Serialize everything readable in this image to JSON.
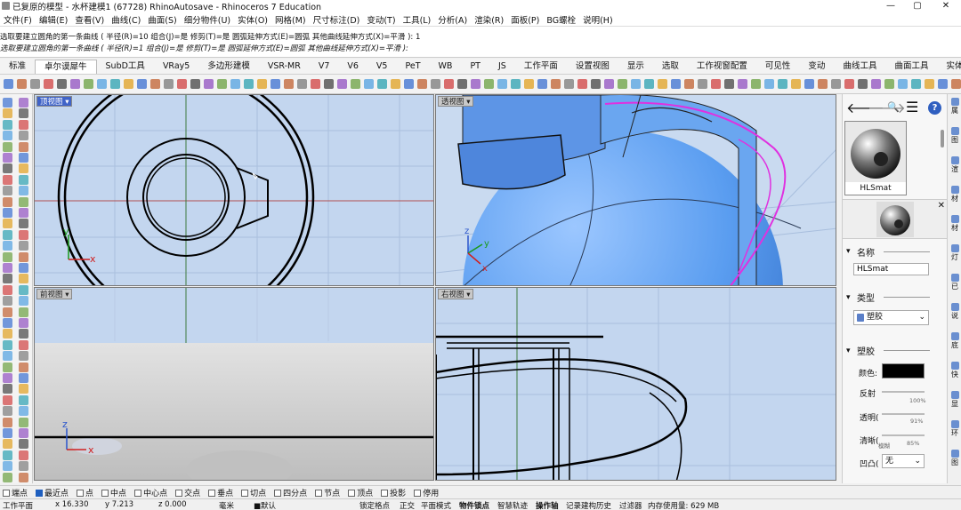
{
  "window": {
    "title": "已复原的模型 - 水杯建模1 (67728) RhinoAutosave - Rhinoceros 7 Education",
    "minimize": "—",
    "maximize": "▢",
    "close": "✕"
  },
  "menu": [
    "文件(F)",
    "编辑(E)",
    "查看(V)",
    "曲线(C)",
    "曲面(S)",
    "细分物件(U)",
    "实体(O)",
    "网格(M)",
    "尺寸标注(D)",
    "变动(T)",
    "工具(L)",
    "分析(A)",
    "渲染(R)",
    "面板(P)",
    "BG螺栓",
    "说明(H)"
  ],
  "command": {
    "line1": "选取要建立圆角的第一条曲线 ( 半径(R)=10  组合(J)=是  修剪(T)=是  圆弧延伸方式(E)=圆弧  其他曲线延伸方式(X)=平滑 ): 1",
    "line2": "选取要建立圆角的第一条曲线 ( 半径(R)=1  组合(J)=是  修剪(T)=是  圆弧延伸方式(E)=圆弧  其他曲线延伸方式(X)=平滑 ):"
  },
  "tabs": [
    "标准",
    "卓尔谟犀牛",
    "SubD工具",
    "VRay5",
    "多边形建模",
    "VSR-MR",
    "V7",
    "V6",
    "V5",
    "PeT",
    "WB",
    "PT",
    "JS",
    "工作平面",
    "设置视图",
    "显示",
    "选取",
    "工作视窗配置",
    "可见性",
    "变动",
    "曲线工具",
    "曲面工具",
    "实体"
  ],
  "active_tab_index": 1,
  "viewports": {
    "top": {
      "label": "顶视图 ▾"
    },
    "perspective": {
      "label": "透视图 ▾"
    },
    "front": {
      "label": "前视图 ▾"
    },
    "right": {
      "label": "右视图 ▾"
    }
  },
  "axes": {
    "x": "x",
    "y": "y",
    "z": "z"
  },
  "panel": {
    "material_name": "HLSmat",
    "section_name": "名称",
    "name_value": "HLSmat",
    "section_type": "类型",
    "type_value": "塑胶",
    "section_plastic": "塑胶",
    "color_label": "颜色:",
    "reflect_label": "反射",
    "reflect_value": "100%",
    "transparency_label": "透明(",
    "transparency_value": "91%",
    "clarity_label": "清晰(",
    "clarity_left": "模糊",
    "clarity_value": "85%",
    "bump_label": "凹凸(",
    "bump_value": "无",
    "nav": {
      "back": "🡐",
      "forward": "🡒",
      "search": "🔍",
      "menu": "☰",
      "help": "?"
    }
  },
  "right_strip": [
    "属",
    "图",
    "渲",
    "材",
    "材",
    "灯",
    "已",
    "说",
    "底",
    "快",
    "显",
    "环",
    "图"
  ],
  "osnaps": [
    {
      "label": "端点",
      "on": false
    },
    {
      "label": "最近点",
      "on": true
    },
    {
      "label": "点",
      "on": false
    },
    {
      "label": "中点",
      "on": false
    },
    {
      "label": "中心点",
      "on": false
    },
    {
      "label": "交点",
      "on": false
    },
    {
      "label": "垂点",
      "on": false
    },
    {
      "label": "切点",
      "on": false
    },
    {
      "label": "四分点",
      "on": false
    },
    {
      "label": "节点",
      "on": false
    },
    {
      "label": "顶点",
      "on": false
    },
    {
      "label": "投影",
      "on": false
    },
    {
      "label": "停用",
      "on": false
    }
  ],
  "status": {
    "plane": "工作平面",
    "x": "x 16.330",
    "y": "y 7.213",
    "z": "z 0.000",
    "unit": "毫米",
    "layer": "■默认",
    "grid_snap": "锁定格点",
    "ortho": "正交",
    "planar": "平面模式",
    "osnap": "物件锁点",
    "smarttrack": "智慧轨迹",
    "gumball": "操作轴",
    "history": "记录建构历史",
    "filter": "过滤器",
    "memory": "内存使用量: 629 MB"
  },
  "colors": {
    "active_label": "#3f63c8",
    "viewport_blue": "#c3d6ef",
    "sphere": "#5a9df0",
    "selection": "#e030e0"
  }
}
